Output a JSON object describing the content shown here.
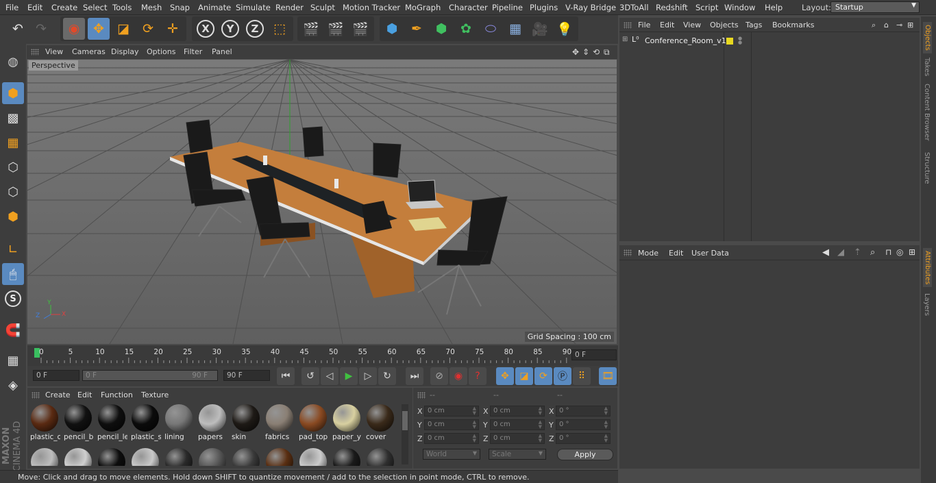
{
  "menu": [
    "File",
    "Edit",
    "Create",
    "Select",
    "Tools",
    "Mesh",
    "Snap",
    "Animate",
    "Simulate",
    "Render",
    "Sculpt",
    "Motion Tracker",
    "MoGraph",
    "Character",
    "Pipeline",
    "Plugins",
    "V-Ray Bridge",
    "3DToAll",
    "Redshift",
    "Script",
    "Window",
    "Help"
  ],
  "layout": {
    "label": "Layout:",
    "value": "Startup"
  },
  "viewport": {
    "menu": [
      "View",
      "Cameras",
      "Display",
      "Options",
      "Filter",
      "Panel"
    ],
    "camera": "Perspective",
    "grid_spacing": "Grid Spacing : 100 cm"
  },
  "axes": {
    "x": "X",
    "y": "Y",
    "z": "Z"
  },
  "timeline": {
    "ticks": [
      "0",
      "5",
      "10",
      "15",
      "20",
      "25",
      "30",
      "35",
      "40",
      "45",
      "50",
      "55",
      "60",
      "65",
      "70",
      "75",
      "80",
      "85",
      "90"
    ],
    "current_frame": "0 F"
  },
  "playback": {
    "start": "0 F",
    "range_start": "0 F",
    "range_end": "90 F",
    "end": "90 F"
  },
  "materials": {
    "menu": [
      "Create",
      "Edit",
      "Function",
      "Texture"
    ],
    "row1": [
      {
        "label": "plastic_c",
        "color": "#5a2a12"
      },
      {
        "label": "pencil_b",
        "color": "#111111"
      },
      {
        "label": "pencil_le",
        "color": "#0e0e0e"
      },
      {
        "label": "plastic_s",
        "color": "#0b0b0b"
      },
      {
        "label": "lining",
        "color": "#777777"
      },
      {
        "label": "papers",
        "color": "#bdbdbd"
      },
      {
        "label": "skin",
        "color": "#1e1a16"
      },
      {
        "label": "fabrics",
        "color": "#8a7f74"
      },
      {
        "label": "pad_top",
        "color": "#8a4a22"
      },
      {
        "label": "paper_y",
        "color": "#d8d0a0"
      },
      {
        "label": "cover",
        "color": "#3a2a1a"
      }
    ],
    "row2_colors": [
      "#bdbdbd",
      "#cfcfcf",
      "#0d0d0d",
      "#c9c9c9",
      "#2a2a2a",
      "#555555",
      "#3a3a3a",
      "#5a2f12",
      "#cccccc",
      "#1a1a1a",
      "#2f2f2f"
    ]
  },
  "coords": {
    "headers": [
      "--",
      "--",
      "--"
    ],
    "rows": [
      {
        "a": "X",
        "v1": "0 cm",
        "b": "X",
        "v2": "0 cm",
        "c": "X",
        "v3": "0 °"
      },
      {
        "a": "Y",
        "v1": "0 cm",
        "b": "Y",
        "v2": "0 cm",
        "c": "Y",
        "v3": "0 °"
      },
      {
        "a": "Z",
        "v1": "0 cm",
        "b": "Z",
        "v2": "0 cm",
        "c": "Z",
        "v3": "0 °"
      }
    ],
    "mode1": "World",
    "mode2": "Scale",
    "apply": "Apply"
  },
  "objects": {
    "menu": [
      "File",
      "Edit",
      "View",
      "Objects",
      "Tags",
      "Bookmarks"
    ],
    "item": "Conference_Room_v1"
  },
  "attributes": {
    "menu": [
      "Mode",
      "Edit",
      "User Data"
    ]
  },
  "right_tabs": [
    "Objects",
    "Takes",
    "Content Browser",
    "Structure",
    "Attributes",
    "Layers"
  ],
  "status": "Move: Click and drag to move elements. Hold down SHIFT to quantize movement / add to the selection in point mode, CTRL to remove.",
  "brand": [
    "MAXON",
    "CINEMA 4D"
  ]
}
